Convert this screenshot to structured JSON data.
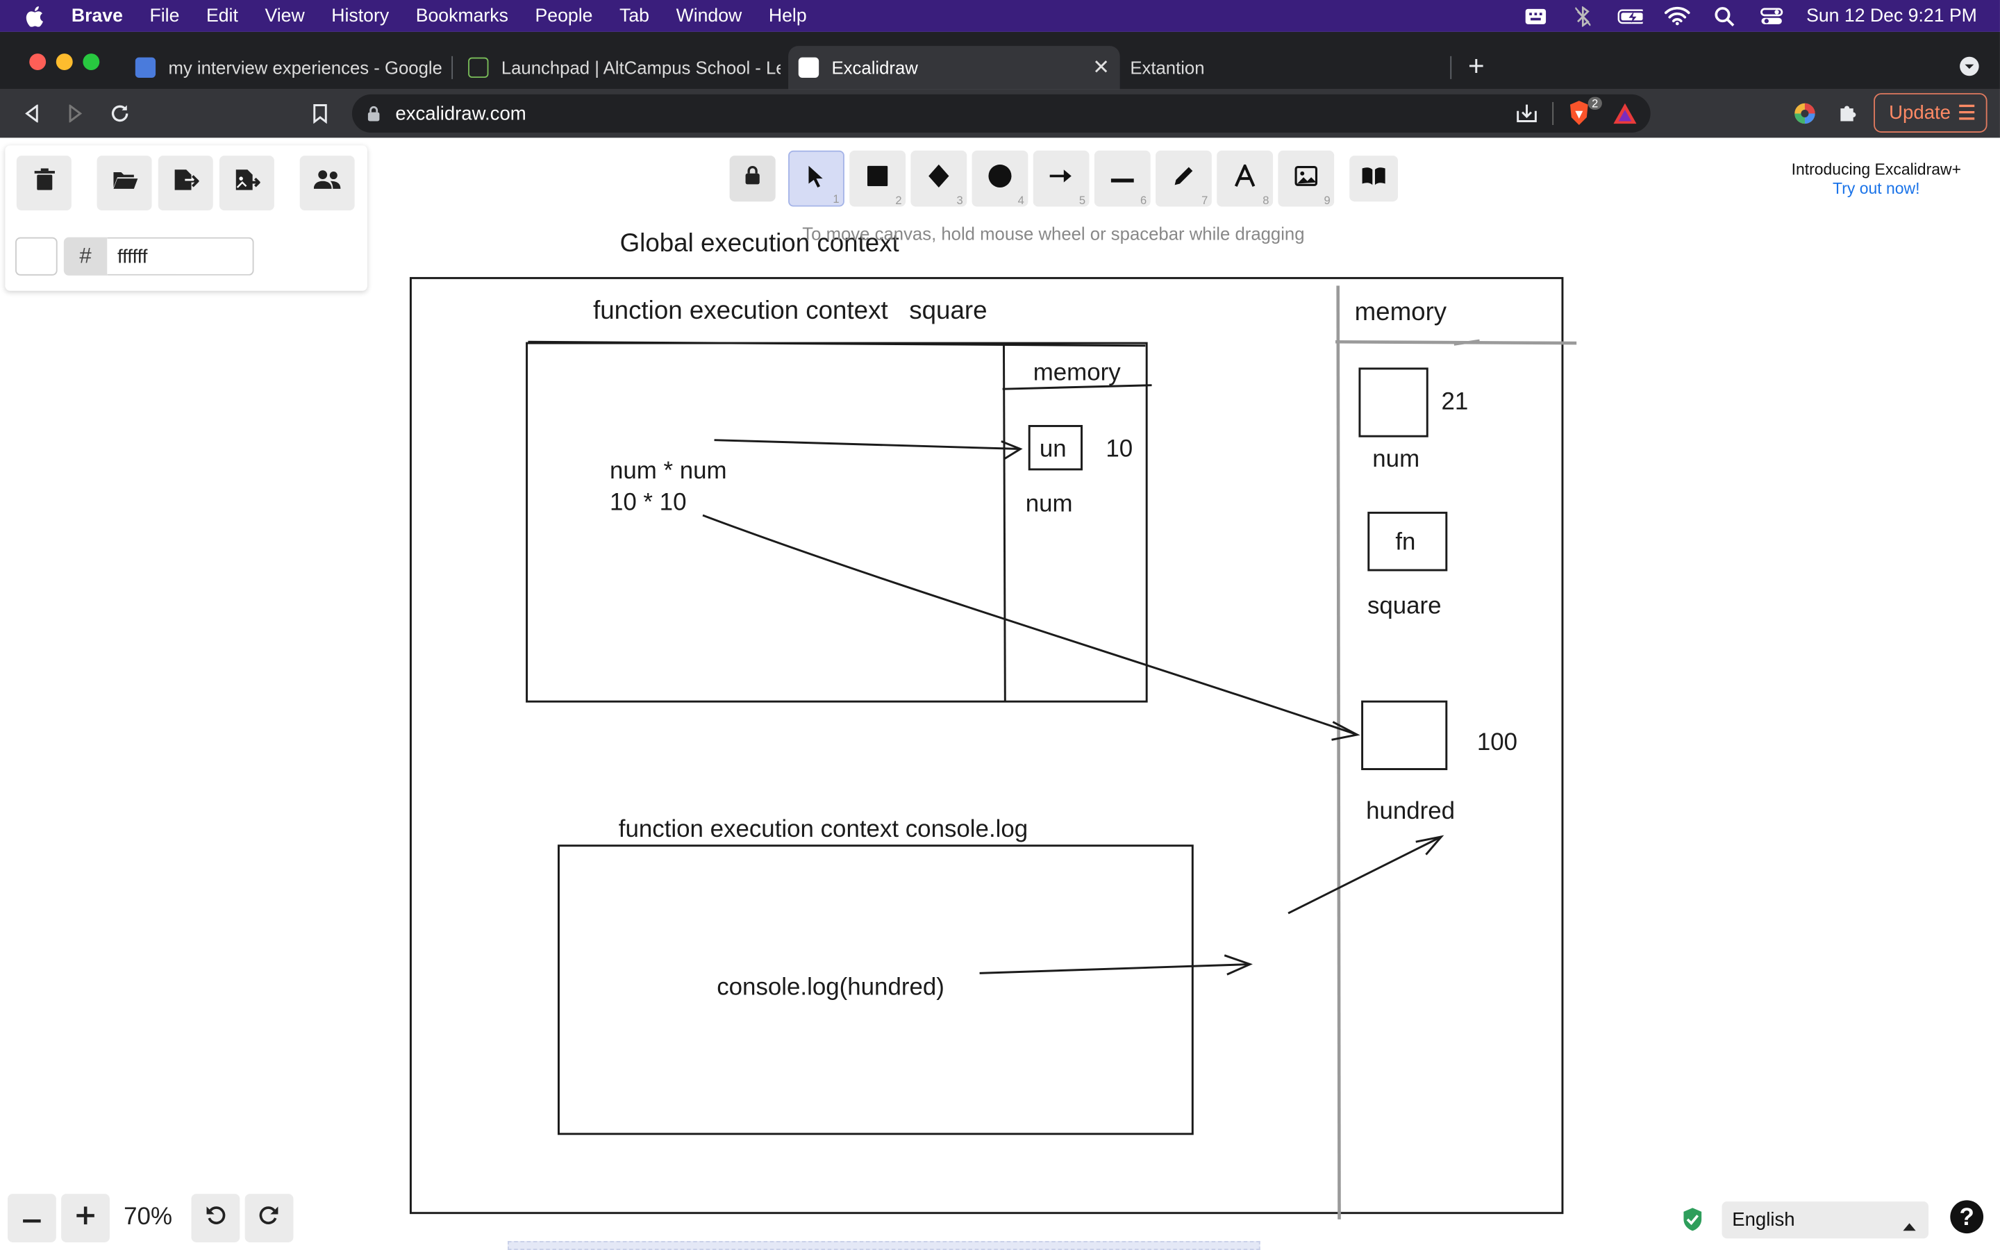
{
  "menubar": {
    "app": "Brave",
    "items": [
      "File",
      "Edit",
      "View",
      "History",
      "Bookmarks",
      "People",
      "Tab",
      "Window",
      "Help"
    ],
    "clock": "Sun 12 Dec  9:21 PM"
  },
  "tabs": [
    {
      "title": "my interview experiences - Google D",
      "favicon_color": "#4a7bdc"
    },
    {
      "title": "Launchpad | AltCampus School - Le",
      "favicon_color": "#7bbf5a"
    },
    {
      "title": "Excalidraw",
      "favicon_color": "#ffffff"
    },
    {
      "title": "Extantion",
      "favicon_color": ""
    }
  ],
  "address": {
    "url": "excalidraw.com",
    "update_label": "Update",
    "brave_badge": "2"
  },
  "left_panel": {
    "hex_hash": "#",
    "hex_value": "ffffff"
  },
  "toolbar": {
    "keys": [
      "1",
      "2",
      "3",
      "4",
      "5",
      "6",
      "7",
      "8",
      "9"
    ],
    "hint": "To move canvas, hold mouse wheel or spacebar while dragging"
  },
  "promo": {
    "line1": "Introducing Excalidraw+",
    "line2": "Try out now!"
  },
  "canvas": {
    "global_title": "Global execution context",
    "fec_square_title": "function execution context   square",
    "memory_label": "memory",
    "inner_memory_label": "memory",
    "un_value": "un",
    "ten": "10",
    "num_inner": "num",
    "expr1": "num * num",
    "expr2": "10 * 10",
    "val_21": "21",
    "num_label": "num",
    "fn_label": "fn",
    "square_label": "square",
    "val_100": "100",
    "hundred_label": "hundred",
    "fec_console_title": "function execution context console.log",
    "console_call": "console.log(hundred)"
  },
  "bottom": {
    "zoom": "70%",
    "language": "English",
    "help": "?"
  },
  "colors": {
    "menubar_bg": "#3a1e7c",
    "tabstrip_bg": "#202124",
    "toolbar_bg": "#35363a",
    "selected_tool": "#d6dcf5",
    "link": "#1a73e8"
  }
}
